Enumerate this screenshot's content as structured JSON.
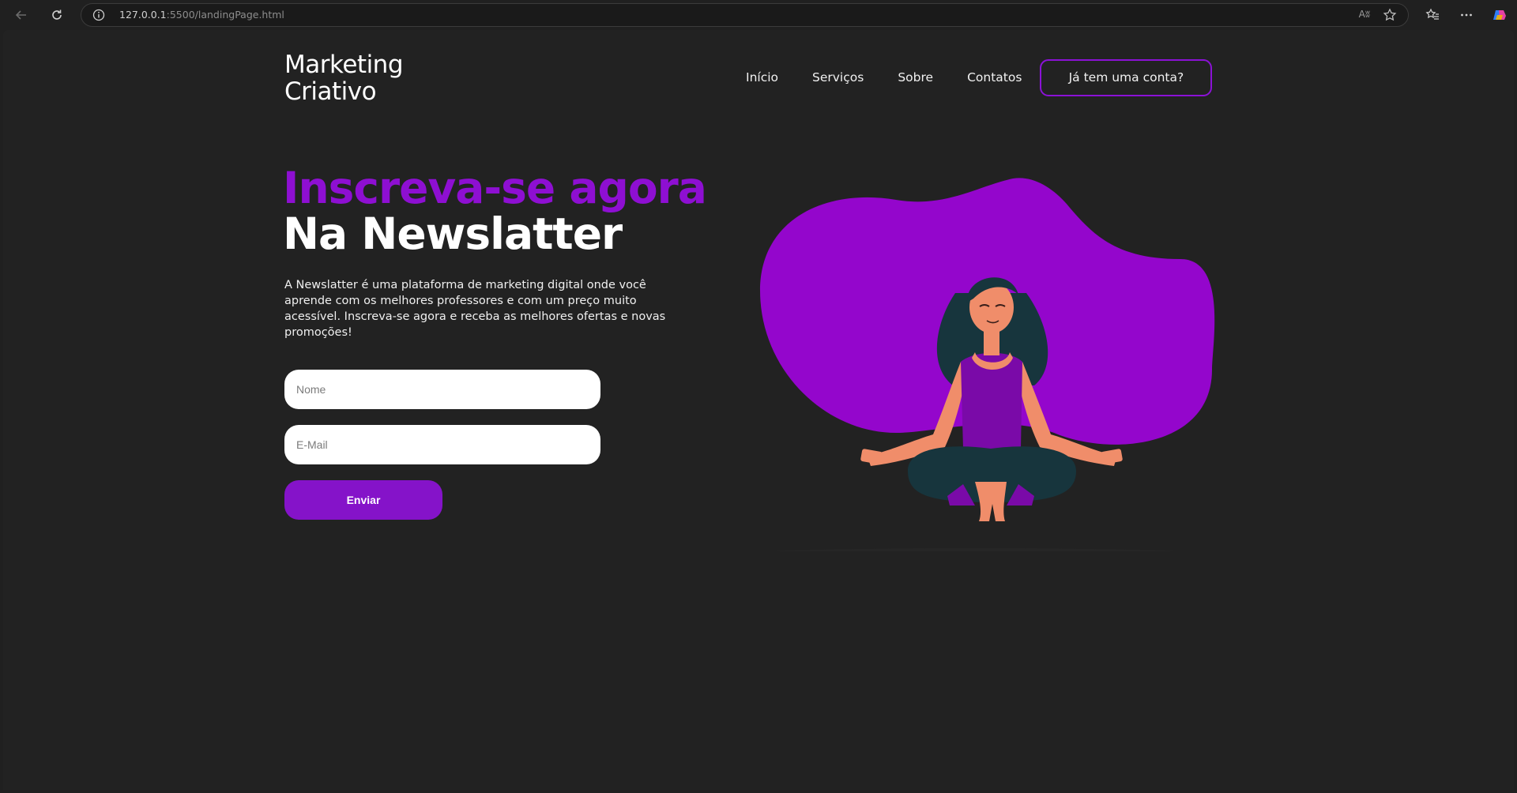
{
  "browser": {
    "url_host": "127.0.0.1",
    "url_path": ":5500/landingPage.html",
    "read_aloud_label": "Aʬ"
  },
  "header": {
    "logo_line1": "Marketing",
    "logo_line2": "Criativo",
    "nav": [
      "Início",
      "Serviços",
      "Sobre",
      "Contatos"
    ],
    "login_label": "Já tem uma conta?"
  },
  "hero": {
    "title_line1": "Inscreva-se agora",
    "title_line2": "Na Newslatter",
    "description": "A Newslatter é uma plataforma de marketing digital onde você aprende com os melhores professores e com um preço muito acessível. Inscreva-se agora e receba as melhores ofertas e novas promoções!"
  },
  "form": {
    "name_placeholder": "Nome",
    "email_placeholder": "E-Mail",
    "submit_label": "Enviar"
  },
  "colors": {
    "accent": "#8e0fd2",
    "button": "#8513c9",
    "blob": "#9406cc",
    "background": "#222222"
  },
  "icons": [
    "back-icon",
    "refresh-icon",
    "info-icon",
    "star-icon",
    "favorites-icon",
    "more-icon",
    "copilot-icon"
  ]
}
